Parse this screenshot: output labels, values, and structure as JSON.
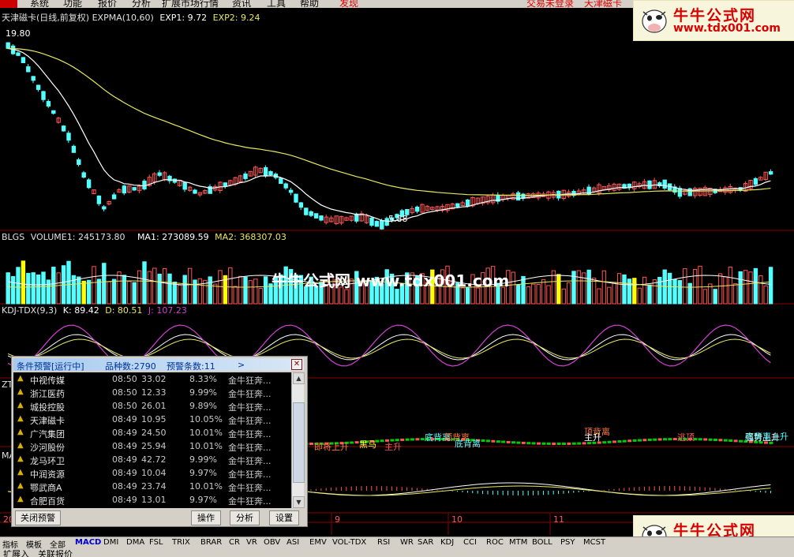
{
  "menu": {
    "items": [
      "系统",
      "功能",
      "报价",
      "分析",
      "扩展市场行情",
      "资讯",
      "工具",
      "帮助"
    ],
    "discover": "发现",
    "right": [
      "交易未登录",
      "天津磁卡"
    ]
  },
  "price_panel": {
    "title": "天津磁卡(日线,前复权)",
    "indicator": "EXPMA(10,60)",
    "exp1": "EXP1: 9.72",
    "exp2": "EXP2: 9.24",
    "high_label": "19.80",
    "low_label": "5.88"
  },
  "volume_panel": {
    "name": "BLGS",
    "volume1": "VOLUME1: 245173.80",
    "ma1": "MA1: 273089.59",
    "ma2": "MA2: 368307.03"
  },
  "kdj_panel": {
    "name": "KDJ-TDX(9,3)",
    "k": "K: 89.42",
    "d": "D: 80.51",
    "j": "J: 107.23"
  },
  "zt_panel": {
    "name": "ZT",
    "labels": [
      "顶背离",
      "底背离",
      "顶背离",
      "底背离",
      "黑马",
      "主升",
      "即将上升",
      "主升",
      "逃顶",
      "强势上升",
      "底背离上升"
    ]
  },
  "macd_panel": {
    "name": "MA"
  },
  "date_axis": {
    "year": "2015年",
    "months": [
      "9",
      "10",
      "11"
    ]
  },
  "watermark": {
    "title": "牛牛公式网",
    "url": "www.tdx001.com",
    "center": "牛牛公式网 www.tdx001.com"
  },
  "alert_popup": {
    "title": "条件预警[运行中]",
    "count": "品种数:2790",
    "alerts": "预警条数:11",
    "rows": [
      {
        "name": "中视传媒",
        "time": "08:50",
        "price": "33.02",
        "pct": "8.33%",
        "formula": "金牛狂奔..."
      },
      {
        "name": "浙江医药",
        "time": "08:50",
        "price": "12.33",
        "pct": "9.99%",
        "formula": "金牛狂奔..."
      },
      {
        "name": "城投控股",
        "time": "08:50",
        "price": "26.01",
        "pct": "9.89%",
        "formula": "金牛狂奔..."
      },
      {
        "name": "天津磁卡",
        "time": "08:49",
        "price": "10.95",
        "pct": "10.05%",
        "formula": "金牛狂奔..."
      },
      {
        "name": "广汽集团",
        "time": "08:49",
        "price": "24.50",
        "pct": "10.01%",
        "formula": "金牛狂奔..."
      },
      {
        "name": "沙河股份",
        "time": "08:49",
        "price": "25.94",
        "pct": "10.01%",
        "formula": "金牛狂奔..."
      },
      {
        "name": "龙马环卫",
        "time": "08:49",
        "price": "42.72",
        "pct": "9.99%",
        "formula": "金牛狂奔..."
      },
      {
        "name": "中润资源",
        "time": "08:49",
        "price": "10.04",
        "pct": "9.97%",
        "formula": "金牛狂奔..."
      },
      {
        "name": "鄂武商A",
        "time": "08:49",
        "price": "23.74",
        "pct": "10.01%",
        "formula": "金牛狂奔..."
      },
      {
        "name": "合肥百货",
        "time": "08:49",
        "price": "13.01",
        "pct": "9.97%",
        "formula": "金牛狂奔..."
      }
    ],
    "buttons": {
      "close": "关闭预警",
      "operate": "操作",
      "analyze": "分析",
      "settings": "设置"
    }
  },
  "indicator_tabs": {
    "left": [
      "指标",
      "模板",
      "全部"
    ],
    "items": [
      "MACD",
      "DMI",
      "DMA",
      "FSL",
      "TRIX",
      "BRAR",
      "CR",
      "VR",
      "OBV",
      "ASI",
      "EMV",
      "VOL-TDX",
      "RSI",
      "WR",
      "SAR",
      "KDJ",
      "CCI",
      "ROC",
      "MTM",
      "BOLL",
      "PSY",
      "MCST"
    ],
    "active": "MACD"
  },
  "status_bar": {
    "items": [
      "扩展入",
      "关联报价"
    ]
  },
  "colors": {
    "up": "#ff5555",
    "down": "#54ffff",
    "ma_white": "#ffffff",
    "ma_yellow": "#e8e860",
    "j_line": "#d040d0",
    "grid": "#8a0000",
    "volume_yellow": "#ffff00",
    "volume_green": "#00cc00"
  }
}
